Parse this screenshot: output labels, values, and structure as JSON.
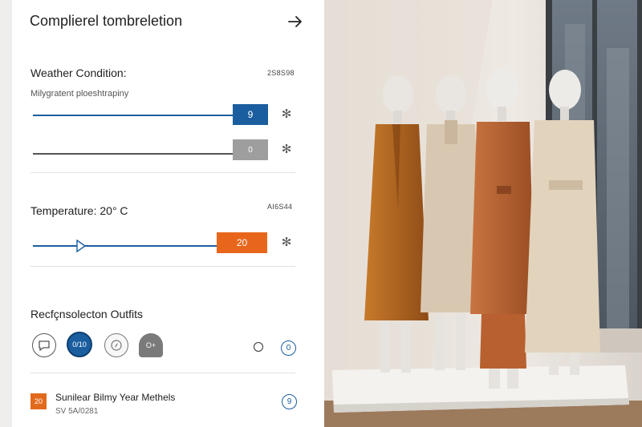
{
  "header": {
    "title": "Complierel tombreletion",
    "arrow_icon": "arrow-right-icon"
  },
  "weather": {
    "title": "Weather Condition:",
    "code": "2S8S98",
    "subtext": "Milygratent ploeshtrapiny",
    "sliders": [
      {
        "value": "9",
        "color": "#1a5ea0",
        "icon": "gear-icon"
      },
      {
        "value": "0",
        "color": "#9e9e9e",
        "icon": "gear-icon"
      }
    ]
  },
  "temperature": {
    "title": "Temperature: 20° C",
    "code": "AI6S44",
    "slider": {
      "value": "20",
      "color": "#e8661c",
      "icon": "gear-icon"
    }
  },
  "outfits": {
    "title": "Recfçnsolecton Outfits",
    "icons": [
      {
        "label": "",
        "name": "chat-icon"
      },
      {
        "label": "0/10",
        "name": "selected-outfit-icon"
      },
      {
        "label": "",
        "name": "compass-icon"
      },
      {
        "label": "O+",
        "name": "add-outfit-icon"
      }
    ],
    "button_label": "0"
  },
  "list": {
    "badge": "20",
    "title": "Sunilear Bilmy Year Methels",
    "subtitle": "SV 5A/0281",
    "button_label": "9"
  },
  "colors": {
    "accent_blue": "#1a5ea0",
    "accent_orange": "#e8661c"
  }
}
